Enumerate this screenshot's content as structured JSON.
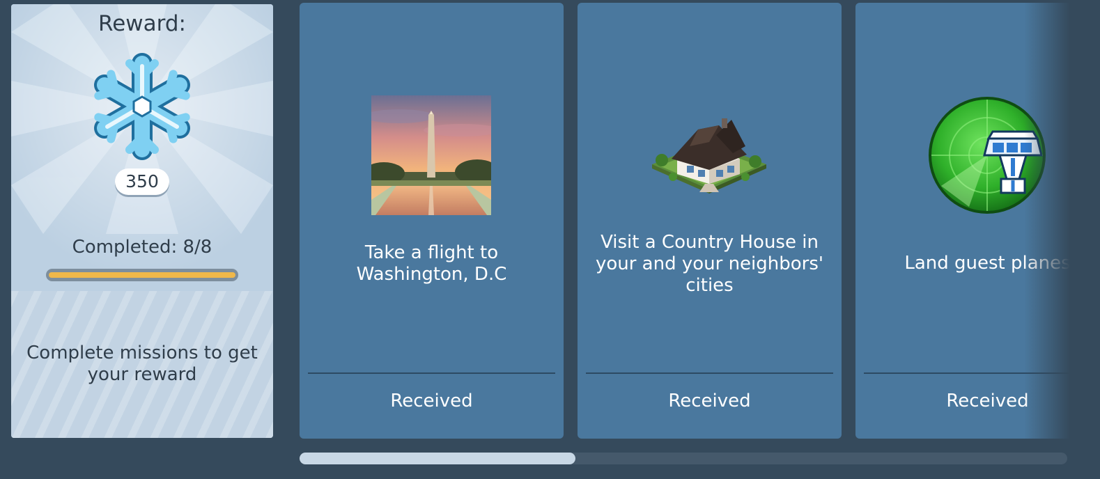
{
  "reward": {
    "title": "Reward:",
    "icon": "snowflake-icon",
    "amount": "350",
    "completed_text": "Completed: 8/8",
    "progress": 1.0,
    "hint": "Complete missions to get your reward"
  },
  "missions": [
    {
      "text": "Take a flight to Washington, D.C",
      "image": "washington-monument-image",
      "status": "Received"
    },
    {
      "text": "Visit a Country House in your and your neighbors' cities",
      "image": "country-house-icon",
      "status": "Received"
    },
    {
      "text": "Land guest planes",
      "image": "radar-tower-icon",
      "status": "Received"
    }
  ],
  "colors": {
    "background": "#354a5c",
    "card": "#4a789e",
    "reward_panel": "#bcd0e2",
    "progress_fill": "#f0b84a"
  }
}
